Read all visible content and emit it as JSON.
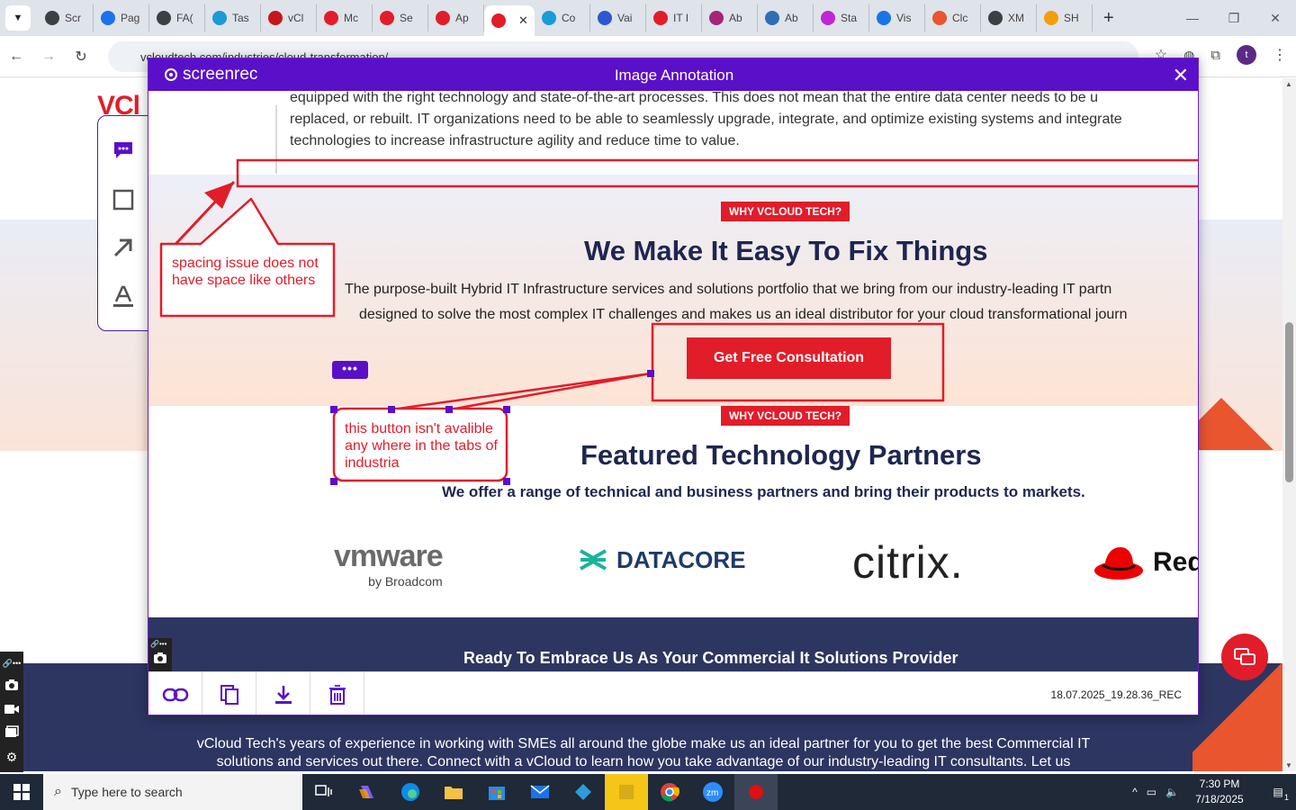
{
  "browser": {
    "tabs": [
      {
        "label": "Scr",
        "color": "#3c4043"
      },
      {
        "label": "Pag",
        "color": "#1a73e8"
      },
      {
        "label": "FA(",
        "color": "#3c4043"
      },
      {
        "label": "Tas",
        "color": "#1a9bd6"
      },
      {
        "label": "vCl",
        "color": "#c4161c"
      },
      {
        "label": "Mc",
        "color": "#e11d2a"
      },
      {
        "label": "Se",
        "color": "#e11d2a"
      },
      {
        "label": "Ap",
        "color": "#e11d2a"
      },
      {
        "label": "",
        "color": "#e11d2a",
        "active": true
      },
      {
        "label": "Co",
        "color": "#1a9bd6"
      },
      {
        "label": "Vai",
        "color": "#2b57d3"
      },
      {
        "label": "IT I",
        "color": "#e11d2a"
      },
      {
        "label": "Ab",
        "color": "#a3267a"
      },
      {
        "label": "Ab",
        "color": "#2d6fb5"
      },
      {
        "label": "Sta",
        "color": "#c026d3"
      },
      {
        "label": "Vis",
        "color": "#1a73e8"
      },
      {
        "label": "Clc",
        "color": "#e8552f"
      },
      {
        "label": "XM",
        "color": "#3c4043"
      },
      {
        "label": "SH",
        "color": "#f59e0b"
      }
    ],
    "url": "vcloudtech.com/industries/cloud-transformation/",
    "profile_initial": "t"
  },
  "site": {
    "logo_v": "VCl",
    "footer_text_1": "vCloud Tech's years of experience in working with SMEs all around the globe make us an ideal partner for you to get the best Commercial IT",
    "footer_text_2": "solutions and services out there. Connect with a vCloud to learn how you take advantage of our industry-leading IT consultants. Let us"
  },
  "modal": {
    "brand": "screenrec",
    "title": "Image Annotation",
    "filename": "18.07.2025_19.28.36_REC"
  },
  "page": {
    "top_para_1": "equipped with the right technology and state-of-the-art processes. This does not mean that the entire data center needs to be u",
    "top_para_2": "replaced, or rebuilt. IT organizations need to be able to seamlessly upgrade, integrate, and optimize existing systems and integrate",
    "top_para_3": "technologies to increase infrastructure agility and reduce time to value.",
    "badge_1": "WHY VCLOUD TECH?",
    "heading_1": "We Make It Easy To Fix Things",
    "para_1a": "The purpose-built Hybrid IT Infrastructure services and solutions portfolio that we bring from our industry-leading IT partn",
    "para_1b": "designed to solve the most complex IT challenges and makes us an ideal distributor for your cloud transformational journ",
    "cta": "Get Free Consultation",
    "badge_2": "WHY VCLOUD TECH?",
    "heading_2": "Featured Technology Partners",
    "para_2": "We offer a range of technical and business partners and bring their products to markets.",
    "partners": {
      "vmware": "vmware",
      "vmware_by": "by Broadcom",
      "datacore": "DATACORE",
      "citrix": "citrix.",
      "redhat": "Red"
    },
    "dark_band_text": "Ready To Embrace Us As Your Commercial It Solutions Provider"
  },
  "annotations": {
    "note_1": "spacing issue does not have space like others",
    "note_2": "this button isn't avalible any where in the tabs of industria",
    "more_label": "•••"
  },
  "taskbar": {
    "search_placeholder": "Type here to search",
    "time": "7:30 PM",
    "date": "7/18/2025",
    "notifications": "1"
  }
}
